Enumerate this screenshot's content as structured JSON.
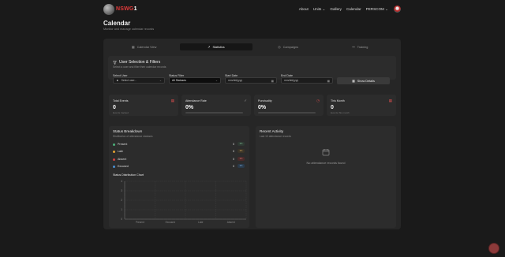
{
  "brand": {
    "red": "NSWG",
    "white": "1"
  },
  "nav": {
    "links": [
      "About",
      "Units",
      "Gallery",
      "Calendar",
      "PERSCOM"
    ]
  },
  "page": {
    "title": "Calendar",
    "subtitle": "Monitor and manage calendar records"
  },
  "tabs": [
    {
      "label": "Calendar View",
      "icon": "calendar-icon"
    },
    {
      "label": "Statistics",
      "icon": "chart-icon",
      "active": true
    },
    {
      "label": "Campaigns",
      "icon": "target-icon"
    },
    {
      "label": "Training",
      "icon": "training-icon"
    }
  ],
  "filters": {
    "title": "User Selection & Filters",
    "subtitle": "Select a user and filter their calendar records",
    "user_label": "Select User",
    "user_value": "Select user...",
    "status_label": "Status Filter",
    "status_value": "All Statuses",
    "start_label": "Start Date",
    "start_value": "mm/dd/yyyy",
    "end_label": "End Date",
    "end_value": "mm/dd/yyyy",
    "show_button": "Show Details"
  },
  "stats": [
    {
      "label": "Total Events",
      "value": "0",
      "desc": "Events tracked",
      "icon": "calendar-x-icon",
      "color": "#c94a4a"
    },
    {
      "label": "Attendance Rate",
      "value": "0%",
      "progress": 0,
      "icon": "check-circle-icon",
      "color": "#9a9a9a"
    },
    {
      "label": "Punctuality",
      "value": "0%",
      "progress": 0,
      "icon": "clock-icon",
      "color": "#c94a4a"
    },
    {
      "label": "This Month",
      "value": "0",
      "desc": "Events this month",
      "icon": "calendar-x-icon",
      "color": "#c94a4a"
    }
  ],
  "breakdown": {
    "title": "Status Breakdown",
    "subtitle": "Distribution of attendance statuses",
    "rows": [
      {
        "name": "Present",
        "count": "0",
        "pct": "0%",
        "color": "#4caf7a",
        "pct_bg": "#2f3a33"
      },
      {
        "name": "Late",
        "count": "0",
        "pct": "0%",
        "color": "#e0a030",
        "pct_bg": "#3a3428"
      },
      {
        "name": "Absent",
        "count": "0",
        "pct": "0%",
        "color": "#d04040",
        "pct_bg": "#4a2a2a"
      },
      {
        "name": "Excused",
        "count": "0",
        "pct": "0%",
        "color": "#4a8fd0",
        "pct_bg": "#2a3a4a"
      }
    ],
    "chart_title": "Status Distribution Chart"
  },
  "chart_data": {
    "type": "bar",
    "categories": [
      "Present",
      "Excused",
      "Late",
      "Absent"
    ],
    "values": [
      0,
      0,
      0,
      0
    ],
    "ylim": [
      0,
      4
    ],
    "yticks": [
      "0",
      "1",
      "2",
      "3",
      "4"
    ],
    "grid": true
  },
  "activity": {
    "title": "Recent Activity",
    "subtitle": "Last 10 attendance records",
    "empty": "No attendance records found"
  }
}
